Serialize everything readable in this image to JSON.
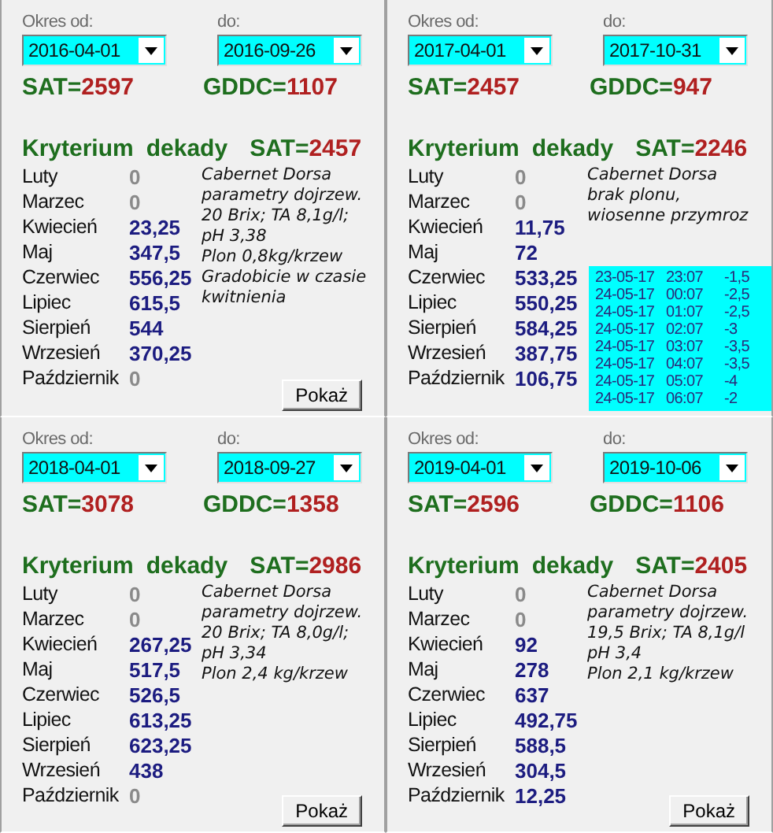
{
  "panels": [
    {
      "from": {
        "label": "Okres od:",
        "value": "2016-04-01"
      },
      "to": {
        "label": "do:",
        "value": "2016-09-26"
      },
      "sat": {
        "label": "SAT=",
        "value": "2597"
      },
      "gddc": {
        "label": "GDDC=",
        "value": "1107"
      },
      "criterion": {
        "word1": "Kryterium",
        "word2": "dekady",
        "sat_label": "SAT=",
        "sat_value": "2457"
      },
      "months": [
        {
          "name": "Luty",
          "value": "0",
          "dimmed": true
        },
        {
          "name": "Marzec",
          "value": "0",
          "dimmed": true
        },
        {
          "name": "Kwiecień",
          "value": "23,25",
          "dimmed": false
        },
        {
          "name": "Maj",
          "value": "347,5",
          "dimmed": false
        },
        {
          "name": "Czerwiec",
          "value": "556,25",
          "dimmed": false
        },
        {
          "name": "Lipiec",
          "value": "615,5",
          "dimmed": false
        },
        {
          "name": "Sierpień",
          "value": "544",
          "dimmed": false
        },
        {
          "name": "Wrzesień",
          "value": "370,25",
          "dimmed": false
        },
        {
          "name": "Październik",
          "value": "0",
          "dimmed": true
        }
      ],
      "notes": [
        "Cabernet Dorsa",
        "parametry dojrzew.",
        "20 Brix; TA 8,1g/l;",
        "pH 3,38",
        "Plon 0,8kg/krzew",
        "Gradobicie w czasie",
        "kwitnienia"
      ],
      "button": "Pokaż"
    },
    {
      "from": {
        "label": "Okres od:",
        "value": "2017-04-01"
      },
      "to": {
        "label": "do:",
        "value": "2017-10-31"
      },
      "sat": {
        "label": "SAT=",
        "value": "2457"
      },
      "gddc": {
        "label": "GDDC=",
        "value": "947"
      },
      "criterion": {
        "word1": "Kryterium",
        "word2": "dekady",
        "sat_label": "SAT=",
        "sat_value": "2246"
      },
      "months": [
        {
          "name": "Luty",
          "value": "0",
          "dimmed": true
        },
        {
          "name": "Marzec",
          "value": "0",
          "dimmed": true
        },
        {
          "name": "Kwiecień",
          "value": "11,75",
          "dimmed": false
        },
        {
          "name": "Maj",
          "value": "72",
          "dimmed": false
        },
        {
          "name": "Czerwiec",
          "value": "533,25",
          "dimmed": false
        },
        {
          "name": "Lipiec",
          "value": "550,25",
          "dimmed": false
        },
        {
          "name": "Sierpień",
          "value": "584,25",
          "dimmed": false
        },
        {
          "name": "Wrzesień",
          "value": "387,75",
          "dimmed": false
        },
        {
          "name": "Październik",
          "value": "106,75",
          "dimmed": false
        }
      ],
      "notes": [
        "Cabernet Dorsa",
        "brak plonu,",
        "wiosenne przymroz"
      ],
      "frost_list": [
        [
          "23-05-17",
          "23:07",
          "-1,5"
        ],
        [
          "24-05-17",
          "00:07",
          "-2,5"
        ],
        [
          "24-05-17",
          "01:07",
          "-2,5"
        ],
        [
          "24-05-17",
          "02:07",
          "-3"
        ],
        [
          "24-05-17",
          "03:07",
          "-3,5"
        ],
        [
          "24-05-17",
          "04:07",
          "-3,5"
        ],
        [
          "24-05-17",
          "05:07",
          "-4"
        ],
        [
          "24-05-17",
          "06:07",
          "-2"
        ]
      ]
    },
    {
      "from": {
        "label": "Okres od:",
        "value": "2018-04-01"
      },
      "to": {
        "label": "do:",
        "value": "2018-09-27"
      },
      "sat": {
        "label": "SAT=",
        "value": "3078"
      },
      "gddc": {
        "label": "GDDC=",
        "value": "1358"
      },
      "criterion": {
        "word1": "Kryterium",
        "word2": "dekady",
        "sat_label": "SAT=",
        "sat_value": "2986"
      },
      "months": [
        {
          "name": "Luty",
          "value": "0",
          "dimmed": true
        },
        {
          "name": "Marzec",
          "value": "0",
          "dimmed": true
        },
        {
          "name": "Kwiecień",
          "value": "267,25",
          "dimmed": false
        },
        {
          "name": "Maj",
          "value": "517,5",
          "dimmed": false
        },
        {
          "name": "Czerwiec",
          "value": "526,5",
          "dimmed": false
        },
        {
          "name": "Lipiec",
          "value": "613,25",
          "dimmed": false
        },
        {
          "name": "Sierpień",
          "value": "623,25",
          "dimmed": false
        },
        {
          "name": "Wrzesień",
          "value": "438",
          "dimmed": false
        },
        {
          "name": "Październik",
          "value": "0",
          "dimmed": true
        }
      ],
      "notes": [
        "Cabernet Dorsa",
        "parametry dojrzew.",
        "20 Brix; TA 8,0g/l;",
        "pH 3,34",
        "Plon 2,4 kg/krzew"
      ],
      "button": "Pokaż"
    },
    {
      "from": {
        "label": "Okres od:",
        "value": "2019-04-01"
      },
      "to": {
        "label": "do:",
        "value": "2019-10-06"
      },
      "sat": {
        "label": "SAT=",
        "value": "2596"
      },
      "gddc": {
        "label": "GDDC=",
        "value": "1106"
      },
      "criterion": {
        "word1": "Kryterium",
        "word2": "dekady",
        "sat_label": "SAT=",
        "sat_value": "2405"
      },
      "months": [
        {
          "name": "Luty",
          "value": "0",
          "dimmed": true
        },
        {
          "name": "Marzec",
          "value": "0",
          "dimmed": true
        },
        {
          "name": "Kwiecień",
          "value": "92",
          "dimmed": false
        },
        {
          "name": "Maj",
          "value": "278",
          "dimmed": false
        },
        {
          "name": "Czerwiec",
          "value": "637",
          "dimmed": false
        },
        {
          "name": "Lipiec",
          "value": "492,75",
          "dimmed": false
        },
        {
          "name": "Sierpień",
          "value": "588,5",
          "dimmed": false
        },
        {
          "name": "Wrzesień",
          "value": "304,5",
          "dimmed": false
        },
        {
          "name": "Październik",
          "value": "12,25",
          "dimmed": false
        }
      ],
      "notes": [
        "Cabernet Dorsa",
        "parametry dojrzew.",
        "19,5 Brix; TA 8,1g/l",
        "pH 3,4",
        "Plon 2,1 kg/krzew"
      ],
      "button": "Pokaż"
    }
  ]
}
